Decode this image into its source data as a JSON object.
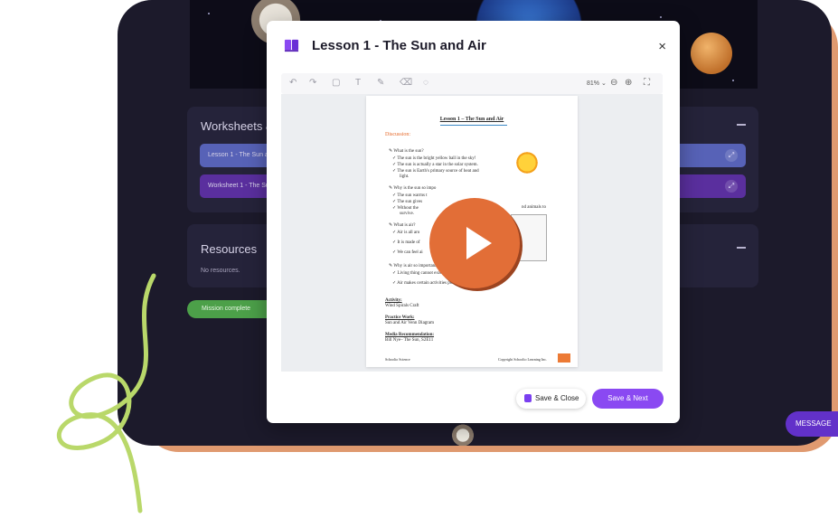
{
  "worksheets": {
    "title": "Worksheets &",
    "rows": [
      "Lesson 1 - The Sun a",
      "Worksheet 1 - The Su"
    ]
  },
  "resources": {
    "title": "Resources",
    "empty": "No resources."
  },
  "mission": {
    "label": "Mission complete"
  },
  "message": {
    "label": "MESSAGE"
  },
  "modal": {
    "title": "Lesson 1 - The Sun and Air",
    "close": "×",
    "toolbar": {
      "zoom": "81% ⌄"
    },
    "save_close": "Save & Close",
    "save_next": "Save & Next"
  },
  "document": {
    "title": "Lesson 1 – The Sun and Air",
    "discussion": "Discussion:",
    "lines": [
      "✎ What is the sun?",
      "✓  The sun is the bright yellow ball in the sky!",
      "✓  The sun is actually a star in the solar system.",
      "✓  The sun is Earth's primary source of heat and",
      "light.",
      "✎ Why is the sun so impo",
      "✓  The sun warms t",
      "✓  The sun gives",
      "✓  Without the",
      "survive.",
      "✎ What is air?",
      "✓  Air is all aro",
      "✓  It is made of",
      "✓  We can feel ai",
      "✎ Why is air so important",
      "✓  Living thing cannot exist without air.",
      "✓  Air makes certain activities possible."
    ],
    "line_tail": "nd animals to",
    "activity_label": "Activity:",
    "activity": "Wind Spirals Craft",
    "practice_label": "Practice Work:",
    "practice": "Sun and Air Venn Diagram",
    "media_label": "Media Recommendation:",
    "media": "Bill Nye– The Sun, S2E11",
    "footer_left": "Schoolio Science",
    "footer_right": "Copyright Schoolio Learning Inc."
  },
  "colors": {
    "accent": "#8a49f2",
    "play": "#e26e37",
    "device": "#1c1a2b"
  }
}
